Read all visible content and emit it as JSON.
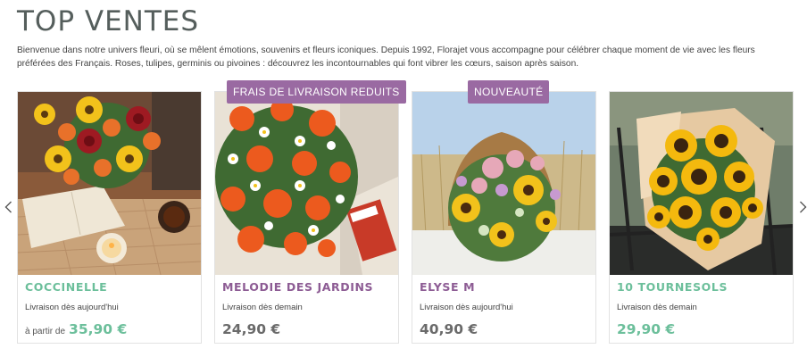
{
  "section": {
    "title": "TOP VENTES",
    "intro": "Bienvenue dans notre univers fleuri, où se mêlent émotions, souvenirs et fleurs iconiques. Depuis 1992, Florajet vous accompagne pour célébrer chaque moment de vie avec les fleurs préférées des Français. Roses, tulipes, germinis ou pivoines : découvrez les incontournables qui font vibrer les cœurs, saison après saison."
  },
  "carousel": {
    "prev_icon": "chevron-left-icon",
    "next_icon": "chevron-right-icon"
  },
  "products": [
    {
      "name": "COCCINELLE",
      "delivery": "Livraison dès aujourd'hui",
      "price_prefix": "à partir de",
      "price": "35,90 €",
      "name_color": "#6cbf9b",
      "price_color": "#6cbf9b"
    },
    {
      "name": "MELODIE DES JARDINS",
      "delivery": "Livraison dès demain",
      "badge": "FRAIS DE LIVRAISON REDUITS",
      "price": "24,90 €",
      "name_color": "#8d5c94",
      "price_color": "#6a6a6a"
    },
    {
      "name": "ELYSE M",
      "delivery": "Livraison dès aujourd'hui",
      "badge": "NOUVEAUTÉ",
      "price": "40,90 €",
      "name_color": "#8d5c94",
      "price_color": "#6a6a6a"
    },
    {
      "name": "10 TOURNESOLS",
      "delivery": "Livraison dès demain",
      "price": "29,90 €",
      "name_color": "#6cbf9b",
      "price_color": "#6cbf9b"
    }
  ]
}
